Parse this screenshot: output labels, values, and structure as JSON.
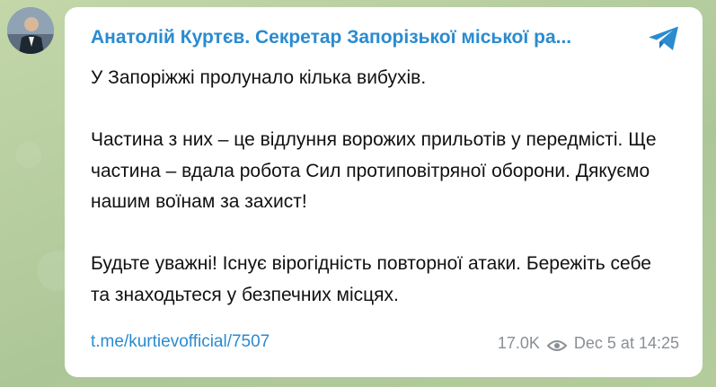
{
  "post": {
    "channel_name": "Анатолій Куртєв. Секретар Запорізької міської ра...",
    "paragraphs": [
      "У Запоріжжі пролунало кілька вибухів.",
      "Частина з них – це відлуння ворожих прильотів у передмісті. Ще частина – вдала робота Сил протиповітряної оборони. Дякуємо нашим воїнам за захист!",
      "Будьте уважні! Існує вірогідність повторної атаки. Бережіть себе та знаходьтеся у безпечних місцях."
    ],
    "link": "t.me/kurtievofficial/7507",
    "views": "17.0K",
    "timestamp": "Dec 5 at 14:25"
  },
  "icons": {
    "share": "telegram-plane-icon",
    "views": "eye-icon"
  },
  "colors": {
    "accent": "#2a8bd0",
    "muted": "#8a8f95",
    "bubble": "#ffffff"
  }
}
